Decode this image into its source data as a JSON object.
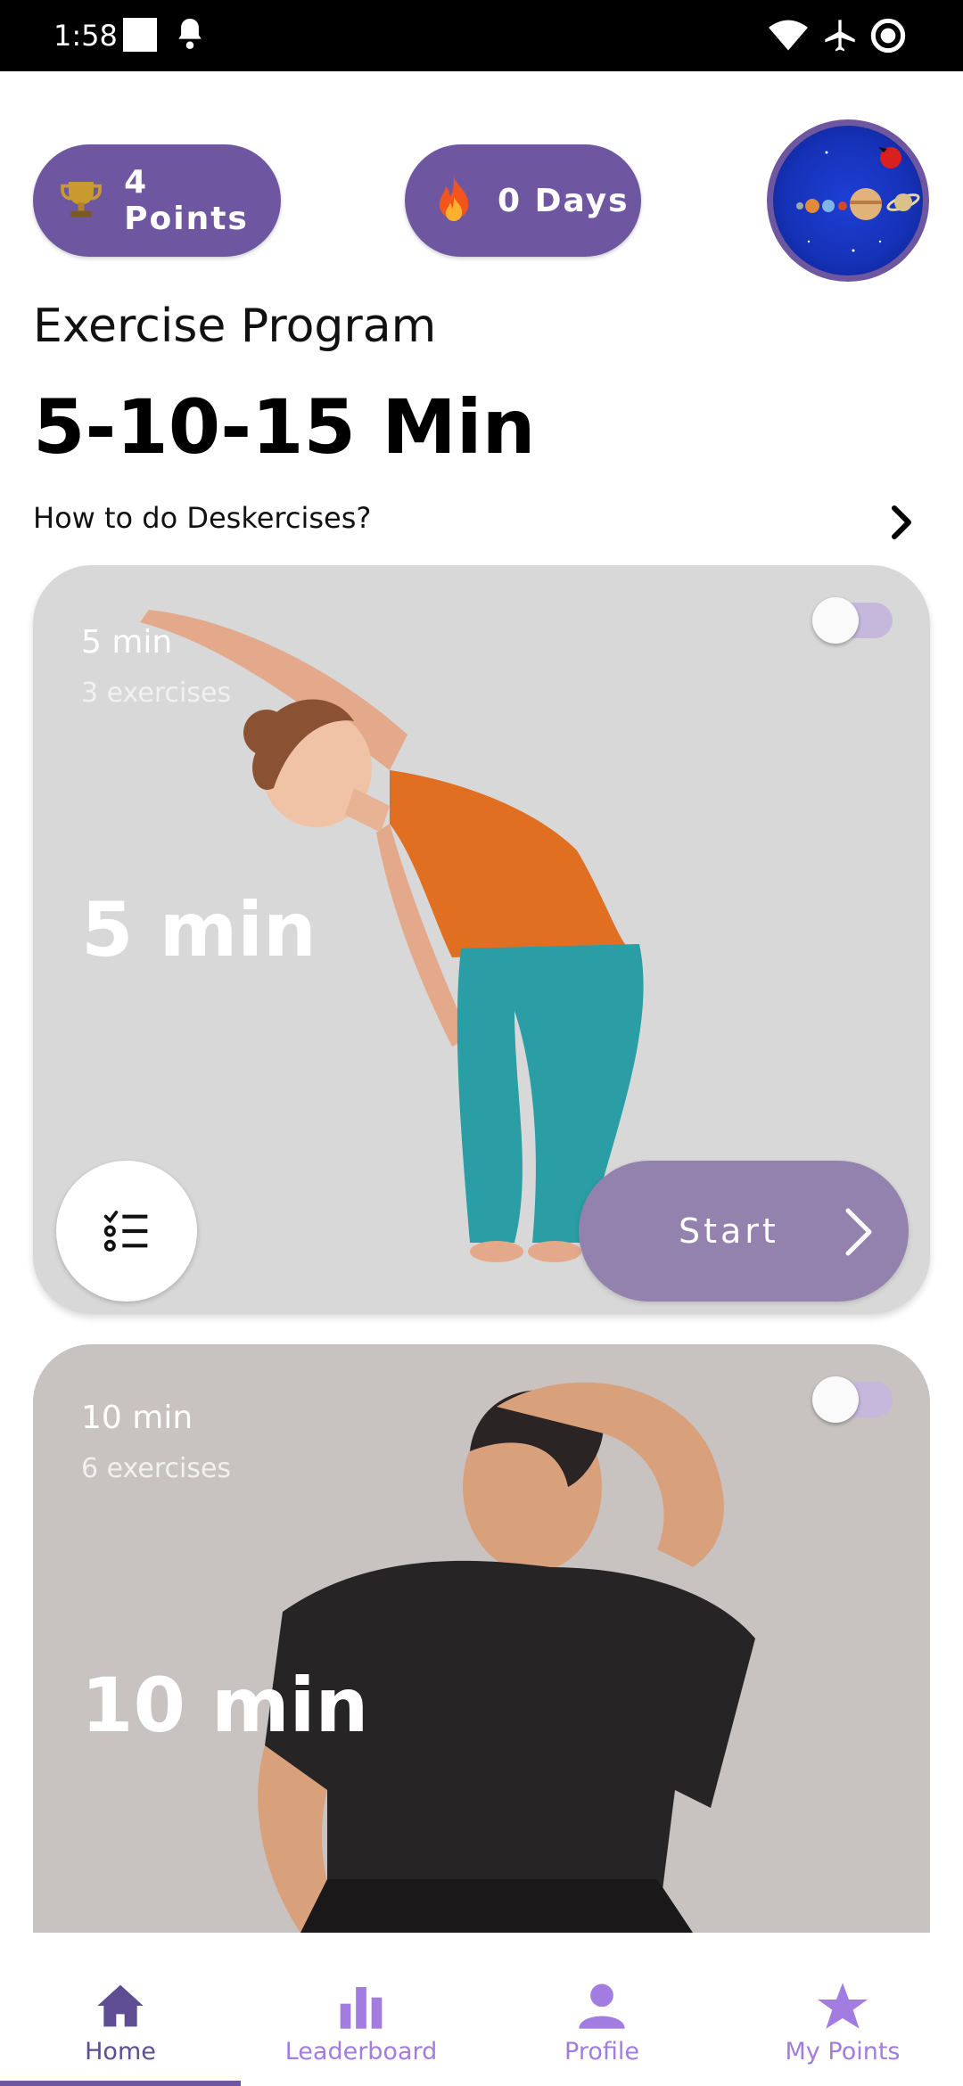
{
  "status_bar": {
    "time": "1:58"
  },
  "header": {
    "points_label": "4 Points",
    "days_label": "0 Days",
    "program_label": "Exercise Program",
    "title": "5-10-15 Min",
    "howto_label": "How to do Deskercises?"
  },
  "cards": [
    {
      "duration_small": "5 min",
      "exercises": "3 exercises",
      "duration_big": "5 min",
      "start_label": "Start",
      "toggle_on": false
    },
    {
      "duration_small": "10 min",
      "exercises": "6 exercises",
      "duration_big": "10 min",
      "toggle_on": false
    }
  ],
  "nav": {
    "items": [
      {
        "label": "Home",
        "icon": "home-icon",
        "active": true
      },
      {
        "label": "Leaderboard",
        "icon": "bar-chart-icon",
        "active": false
      },
      {
        "label": "Profile",
        "icon": "person-icon",
        "active": false
      },
      {
        "label": "My Points",
        "icon": "star-icon",
        "active": false
      }
    ]
  },
  "colors": {
    "accent": "#6e57a0",
    "start_button": "#9282ad",
    "nav_inactive": "#a27ce0",
    "nav_active": "#5e4d93"
  }
}
